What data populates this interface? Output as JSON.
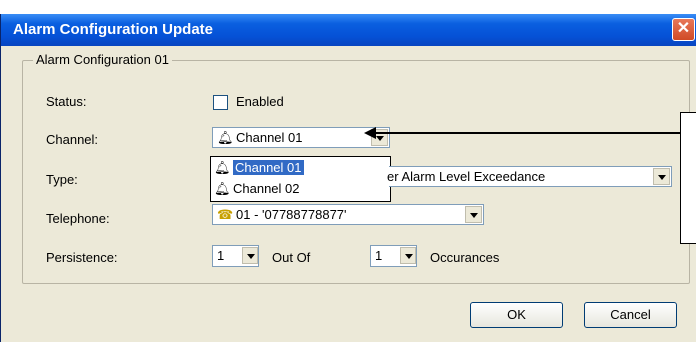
{
  "window": {
    "title": "Alarm Configuration Update",
    "close_label": "✕"
  },
  "group": {
    "legend": "Alarm Configuration 01"
  },
  "status": {
    "label": "Status:",
    "checkbox_label": "Enabled",
    "checked": false
  },
  "channel": {
    "label": "Channel:",
    "value": "Channel 01",
    "options": [
      "Channel 01",
      "Channel 02"
    ]
  },
  "type": {
    "label": "Type:",
    "value_visible": "er Alarm Level Exceedance"
  },
  "telephone": {
    "label": "Telephone:",
    "value": "01  -  '07788778877'"
  },
  "persistence": {
    "label": "Persistence:",
    "value1": "1",
    "out_of": "Out Of",
    "value2": "1",
    "occurances": "Occurances"
  },
  "buttons": {
    "ok": "OK",
    "cancel": "Cancel"
  },
  "icons": {
    "channel": "bell-icon",
    "telephone": "phone-icon"
  },
  "colors": {
    "title_bar": "#0551d6",
    "selection": "#316ac5",
    "dialog_bg": "#ece9d8"
  }
}
